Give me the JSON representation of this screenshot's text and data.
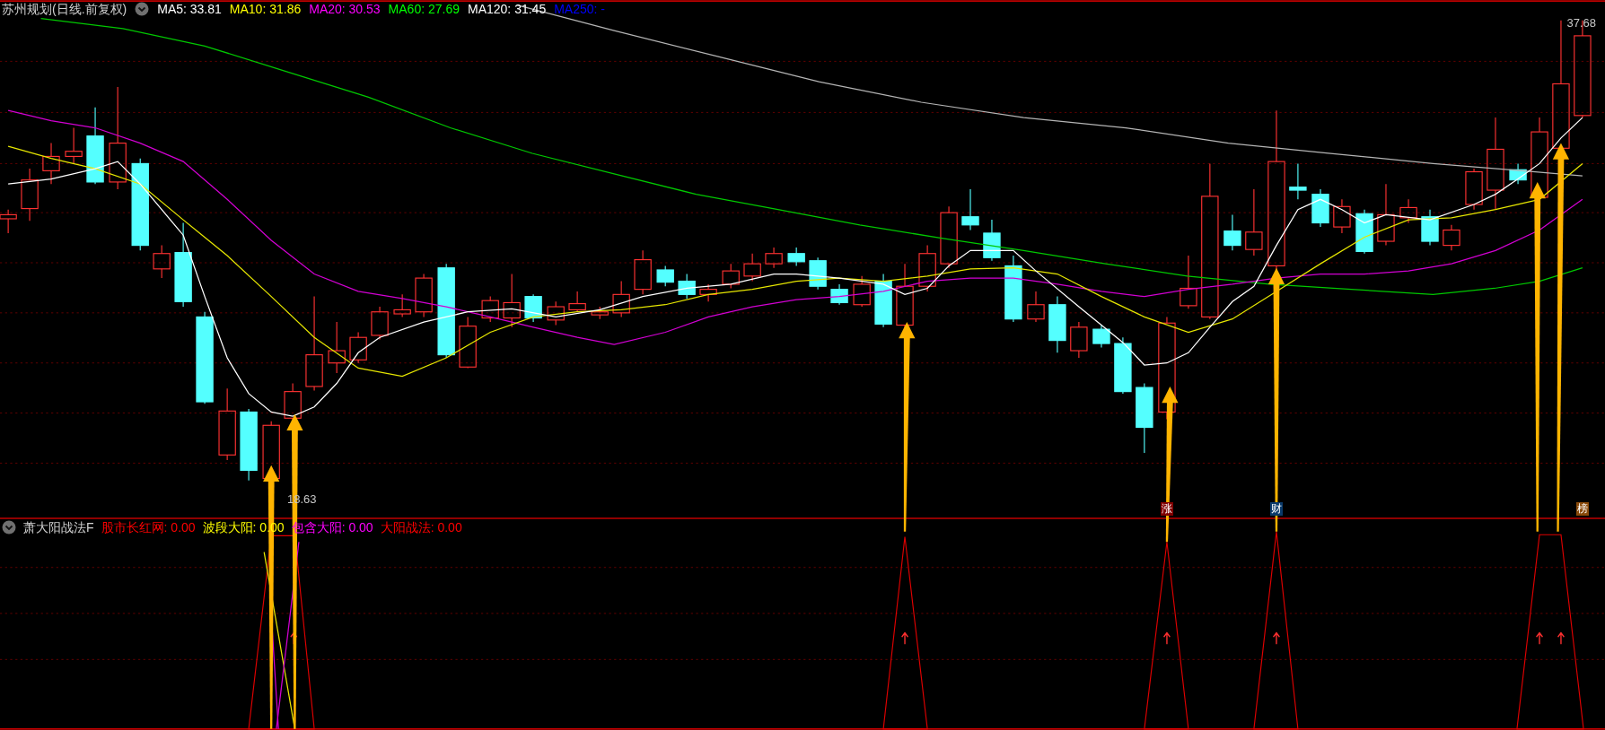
{
  "main_panel": {
    "title": "苏州规划(日线.前复权)",
    "legend": [
      {
        "text": "MA5: 33.81",
        "color": "#ffffff"
      },
      {
        "text": "MA10: 31.86",
        "color": "#ffff00"
      },
      {
        "text": "MA20: 30.53",
        "color": "#ff00ff"
      },
      {
        "text": "MA60: 27.69",
        "color": "#00ff00"
      },
      {
        "text": "MA120: 31.45",
        "color": "#ffffff"
      },
      {
        "text": "MA250: -",
        "color": "#0000ff"
      }
    ],
    "high_label": "37.68",
    "low_label": "18.63",
    "badges": [
      {
        "text": "涨",
        "color": "#800000"
      },
      {
        "text": "财",
        "color": "#0a3a6a"
      },
      {
        "text": "榜",
        "color": "#8a4a0a"
      }
    ]
  },
  "indicator_panel": {
    "title": "萧大阳战法F",
    "legend": [
      {
        "text": "股市长红网: 0.00",
        "color": "#ff0000"
      },
      {
        "text": "波段大阳: 0.00",
        "color": "#ffff00"
      },
      {
        "text": "包含大阳: 0.00",
        "color": "#ff00ff"
      },
      {
        "text": "大阳战法: 0.00",
        "color": "#ff0000"
      }
    ]
  }
}
